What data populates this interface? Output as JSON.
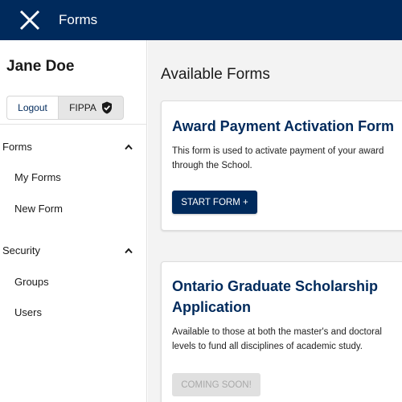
{
  "header": {
    "title": "Forms",
    "close_icon": "close-icon"
  },
  "user": {
    "name": "Jane Doe"
  },
  "auth": {
    "logout_label": "Logout",
    "fippa_label": "FIPPA",
    "fippa_icon": "shield-check-icon"
  },
  "sidebar": {
    "sections": [
      {
        "label": "Forms",
        "expanded": true,
        "items": [
          "My Forms",
          "New Form"
        ]
      },
      {
        "label": "Security",
        "expanded": true,
        "items": [
          "Groups",
          "Users"
        ]
      }
    ]
  },
  "main": {
    "title": "Available Forms",
    "cards": [
      {
        "title": "Award Payment Activation Form",
        "description": [
          "This form is used to activate payment of your award",
          "through the School."
        ],
        "button_label": "START FORM +",
        "button_enabled": true
      },
      {
        "title": [
          "Ontario Graduate Scholarship",
          "Application"
        ],
        "description": [
          "Available to those at both the master's and doctoral",
          "levels to fund all disciplines of academic study."
        ],
        "button_label": "COMING SOON!",
        "button_enabled": false
      }
    ]
  },
  "colors": {
    "primary": "#002a5c",
    "background": "#f3f3f3",
    "disabled": "#e0e0e0"
  }
}
